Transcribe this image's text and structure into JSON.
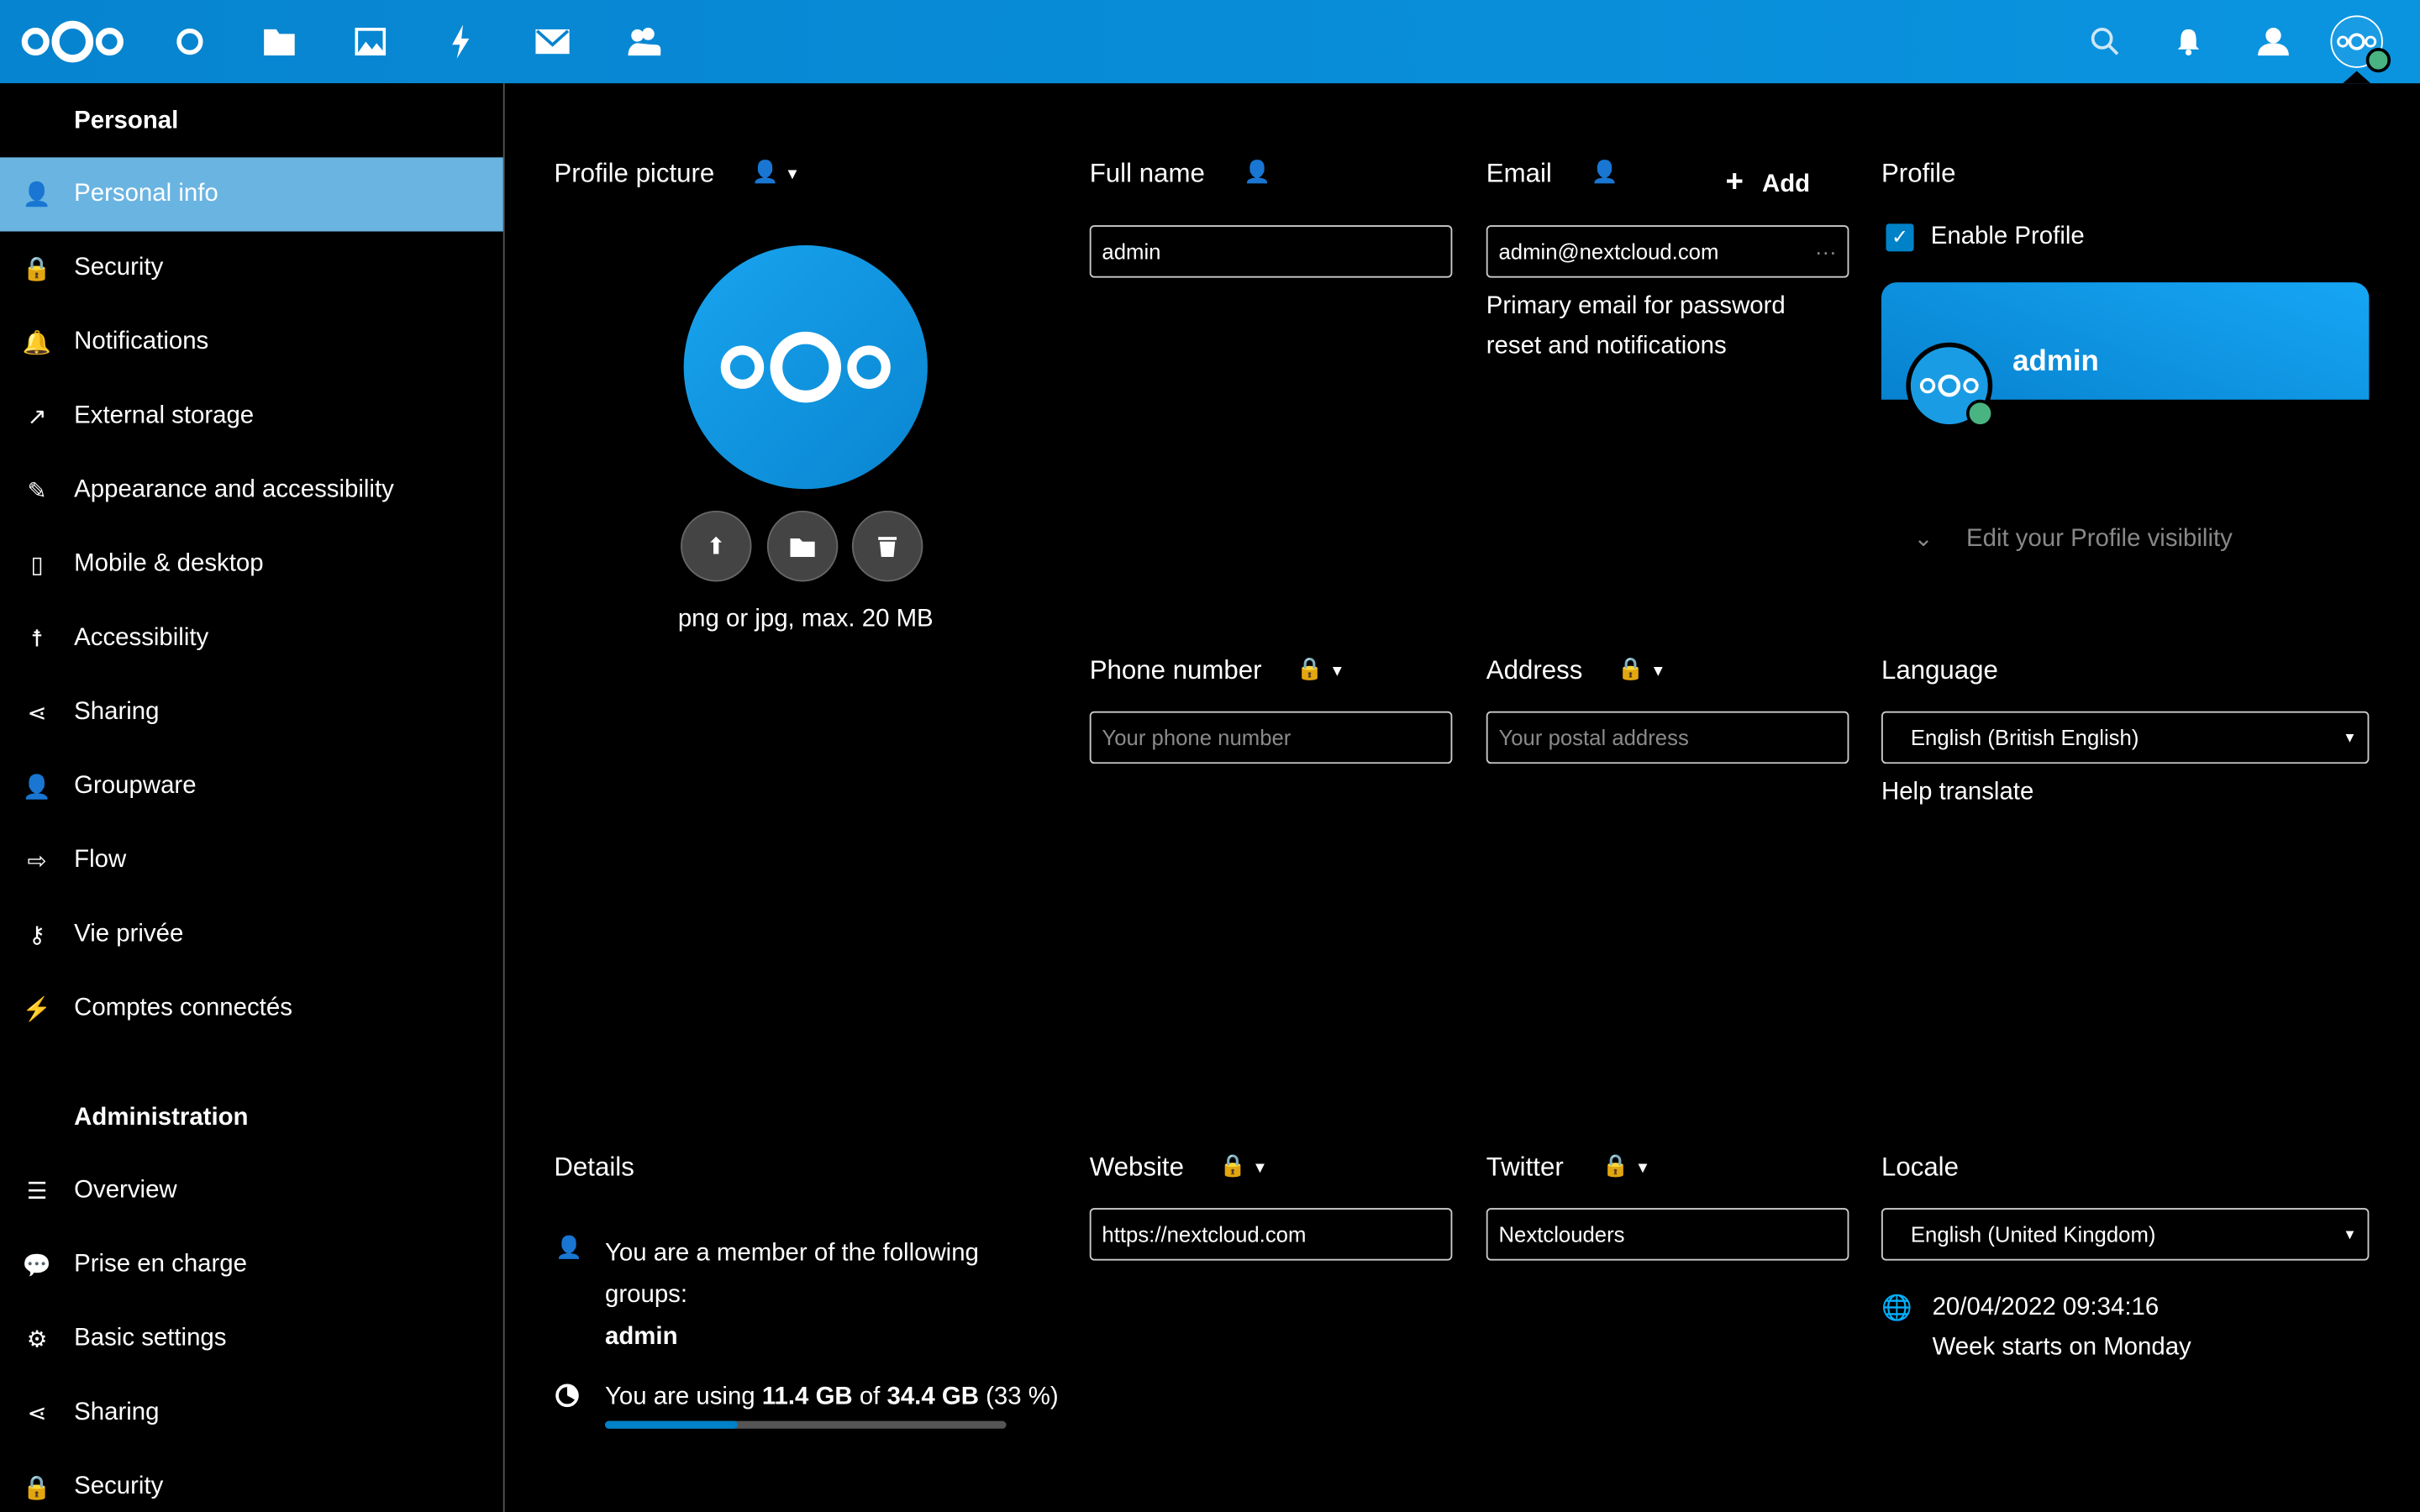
{
  "header": {
    "nav_icons": [
      "nextcloud-logo",
      "dashboard-icon",
      "files-icon",
      "photos-icon",
      "activity-icon",
      "mail-icon",
      "contacts-icon"
    ],
    "right_icons": [
      "search-icon",
      "notifications-icon",
      "contacts-menu-icon",
      "user-avatar"
    ],
    "accent": "#0082c9"
  },
  "sidebar": {
    "personal_heading": "Personal",
    "personal_items": [
      {
        "label": "Personal info",
        "icon": "user-icon"
      },
      {
        "label": "Security",
        "icon": "lock-icon"
      },
      {
        "label": "Notifications",
        "icon": "bell-icon"
      },
      {
        "label": "External storage",
        "icon": "external-icon"
      },
      {
        "label": "Appearance and accessibility",
        "icon": "brush-icon"
      },
      {
        "label": "Mobile & desktop",
        "icon": "phone-icon"
      },
      {
        "label": "Accessibility",
        "icon": "accessibility-icon"
      },
      {
        "label": "Sharing",
        "icon": "share-icon"
      },
      {
        "label": "Groupware",
        "icon": "groupware-icon"
      },
      {
        "label": "Flow",
        "icon": "flow-icon"
      },
      {
        "label": "Vie privée",
        "icon": "key-icon"
      },
      {
        "label": "Comptes connectés",
        "icon": "plug-icon"
      }
    ],
    "admin_heading": "Administration",
    "admin_items": [
      {
        "label": "Overview",
        "icon": "list-icon"
      },
      {
        "label": "Prise en charge",
        "icon": "chat-icon"
      },
      {
        "label": "Basic settings",
        "icon": "gear-icon"
      },
      {
        "label": "Sharing",
        "icon": "share-icon"
      },
      {
        "label": "Security",
        "icon": "lock-icon"
      }
    ]
  },
  "profile_picture": {
    "label": "Profile picture",
    "hint": "png or jpg, max. 20 MB"
  },
  "full_name": {
    "label": "Full name",
    "value": "admin"
  },
  "email": {
    "label": "Email",
    "add": "Add",
    "value": "admin@nextcloud.com",
    "more": "···",
    "hint": "Primary email for password reset and notifications"
  },
  "profile": {
    "label": "Profile",
    "enable": "Enable Profile",
    "enabled": true,
    "name": "admin",
    "visibility": "Edit your Profile visibility"
  },
  "phone": {
    "label": "Phone number",
    "placeholder": "Your phone number"
  },
  "address": {
    "label": "Address",
    "placeholder": "Your postal address"
  },
  "language": {
    "label": "Language",
    "value": "English (British English)",
    "help": "Help translate"
  },
  "details": {
    "label": "Details",
    "groups_text": "You are a member of the following groups:",
    "group": "admin",
    "usage_pre": "You are using ",
    "used": "11.4 GB",
    "of": " of ",
    "total": "34.4 GB",
    "percent_text": "(33 %)",
    "percent": 33
  },
  "website": {
    "label": "Website",
    "value": "https://nextcloud.com"
  },
  "twitter": {
    "label": "Twitter",
    "value": "Nextclouders"
  },
  "locale": {
    "label": "Locale",
    "value": "English (United Kingdom)",
    "time": "20/04/2022 09:34:16",
    "week": "Week starts on Monday"
  }
}
